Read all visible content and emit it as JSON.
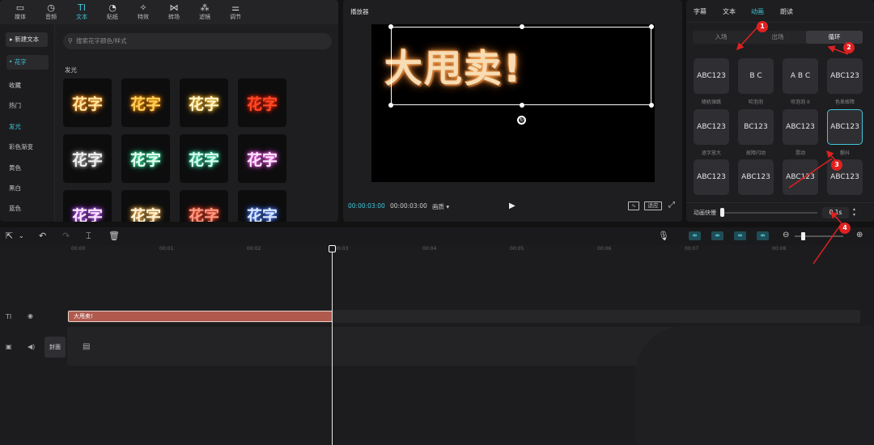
{
  "top_tabs": [
    {
      "label": "媒体",
      "icon": "media-icon"
    },
    {
      "label": "音频",
      "icon": "audio-icon"
    },
    {
      "label": "文本",
      "icon": "text-icon",
      "active": true
    },
    {
      "label": "贴纸",
      "icon": "sticker-icon"
    },
    {
      "label": "特效",
      "icon": "effects-icon"
    },
    {
      "label": "转场",
      "icon": "transition-icon"
    },
    {
      "label": "滤镜",
      "icon": "filter-icon"
    },
    {
      "label": "调节",
      "icon": "adjust-icon"
    }
  ],
  "left_nav": {
    "new_text": "新建文本",
    "items": [
      "花字",
      "收藏",
      "热门",
      "发光",
      "彩色渐变",
      "黄色",
      "黑白",
      "蓝色"
    ]
  },
  "search_placeholder": "搜索花字颜色/样式",
  "section_label": "发光",
  "tile_text": "花字",
  "player": {
    "title": "播放器",
    "overlay_text": "大甩卖!",
    "current_time": "00:00:03:00",
    "total_time": "00:00:03:00",
    "quality": "画质",
    "fit_label": "适应"
  },
  "anim_panel": {
    "tabs": [
      "字幕",
      "文本",
      "动画",
      "朗读"
    ],
    "segments": [
      "入场",
      "出场",
      "循环"
    ],
    "cards": [
      {
        "label": "随机弹跳",
        "preview": "ABC123"
      },
      {
        "label": "吹泡泡",
        "preview": "B C"
      },
      {
        "label": "吹泡泡 II",
        "preview": "A B C"
      },
      {
        "label": "色差故障",
        "preview": "ABC123"
      },
      {
        "label": "逐字放大",
        "preview": "ABC123"
      },
      {
        "label": "故障闪动",
        "preview": "BC123"
      },
      {
        "label": "晃动",
        "preview": "ABC123"
      },
      {
        "label": "颤抖",
        "preview": "ABC123",
        "selected": true
      },
      {
        "label": "",
        "preview": "ABC123"
      },
      {
        "label": "",
        "preview": "ABC123"
      },
      {
        "label": "",
        "preview": "ABC123"
      },
      {
        "label": "",
        "preview": "ABC123"
      }
    ],
    "speed_label": "动画快慢",
    "speed_value": "0.1s"
  },
  "timeline": {
    "ticks": [
      "00:00",
      "00:01",
      "00:02",
      "00:03",
      "00:04",
      "00:05",
      "00:06",
      "00:07",
      "00:08"
    ],
    "clip_label": "大甩卖!",
    "cover_label": "封面"
  },
  "annotations": [
    "1",
    "2",
    "3",
    "4"
  ],
  "colors": {
    "accent": "#3fc6d8",
    "annotation": "#e02020",
    "clip": "#b05a4e"
  }
}
